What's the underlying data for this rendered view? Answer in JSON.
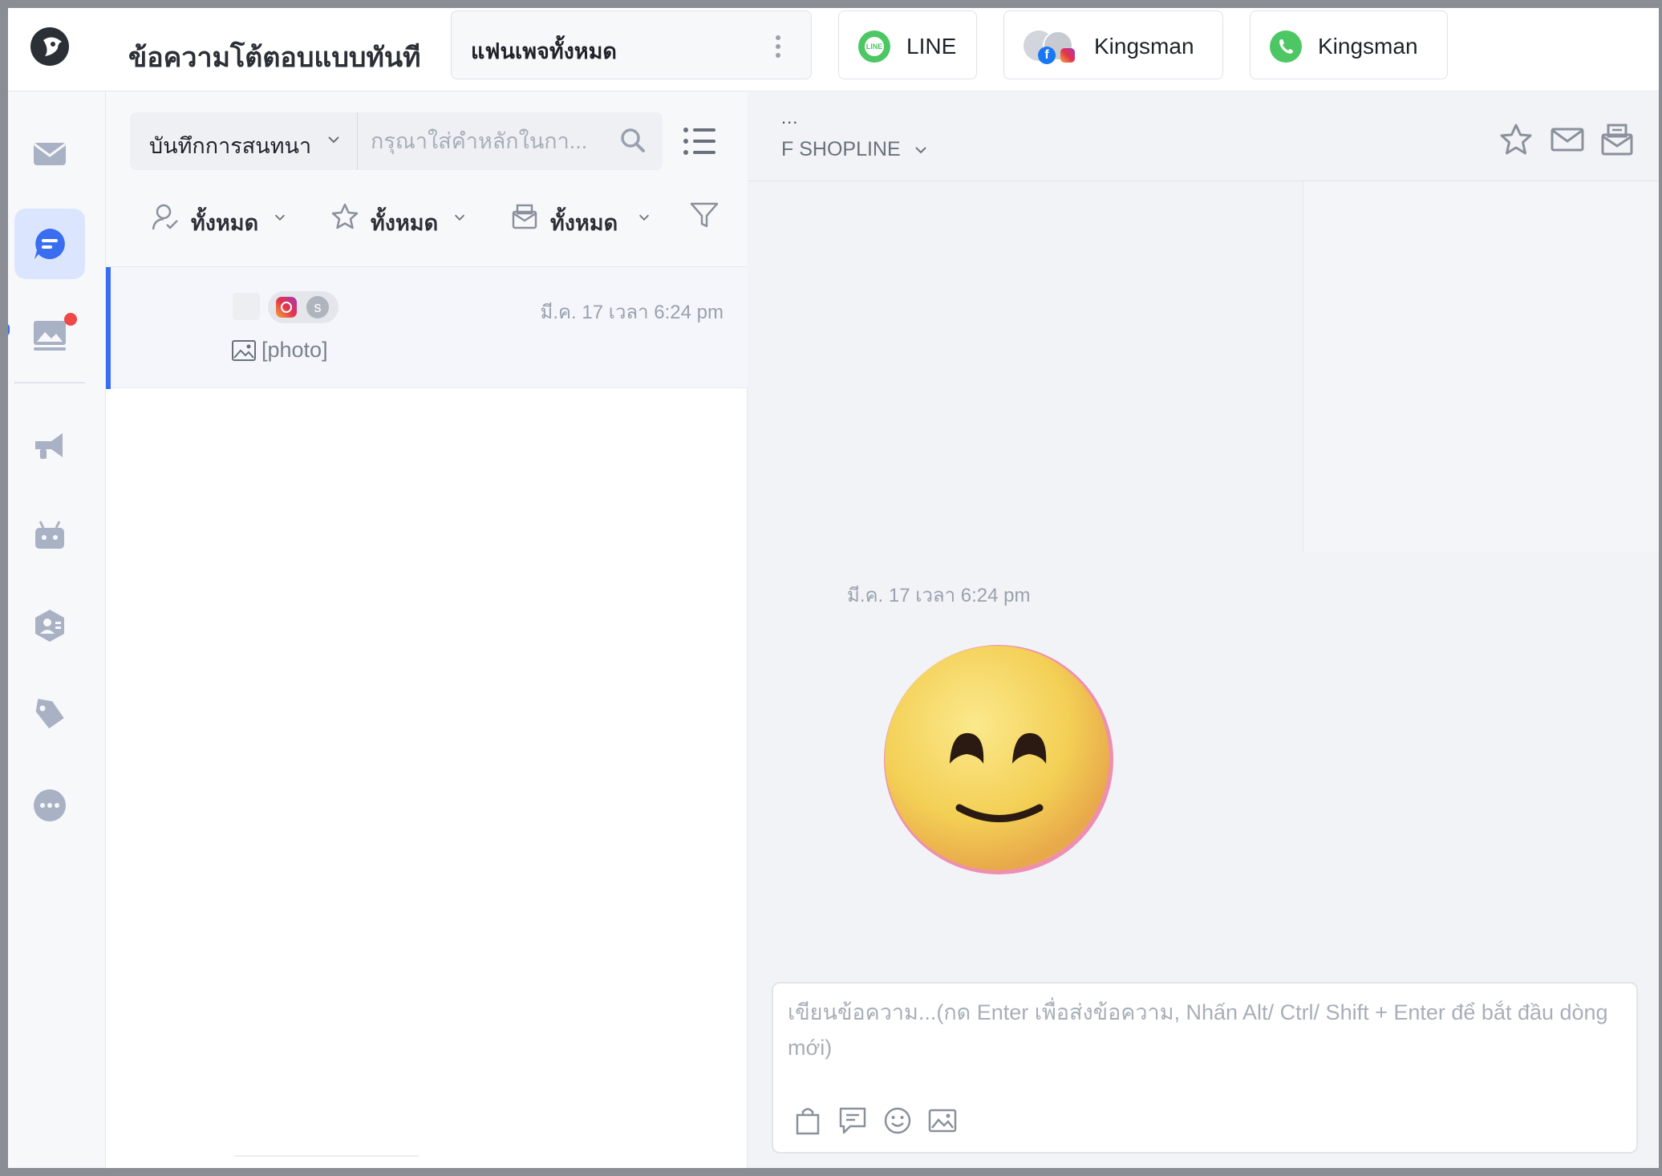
{
  "topbar": {
    "app_title": "ข้อความโต้ตอบแบบทันที",
    "page_selector": "แฟนเพจทั้งหมด",
    "channels": [
      {
        "name": "LINE",
        "icon": "line-icon"
      },
      {
        "name": "Kingsman",
        "icon": "facebook-instagram-stack-icon"
      },
      {
        "name": "Kingsman",
        "icon": "whatsapp-icon"
      }
    ]
  },
  "nav": {
    "items": [
      "inbox-icon",
      "chat-icon",
      "broadcast-image-icon",
      "megaphone-icon",
      "bot-icon",
      "customer-icon",
      "tag-icon",
      "more-icon"
    ],
    "active": "chat-icon",
    "accent": "#3a6df0"
  },
  "list": {
    "scope_label": "บันทึกการสนทนา",
    "search_placeholder": "กรุณาใส่คำหลักในกา...",
    "filters": [
      {
        "label": "ทั้งหมด",
        "icon": "assignee-icon"
      },
      {
        "label": "ทั้งหมด",
        "icon": "star-icon"
      },
      {
        "label": "ทั้งหมด",
        "icon": "mailbox-icon"
      }
    ],
    "conversations": [
      {
        "badge_letter": "s",
        "time": "มี.ค. 17 เวลา 6:24 pm",
        "preview": "[photo]"
      }
    ]
  },
  "chat": {
    "header_name": "...",
    "account": "F SHOPLINE",
    "message_time": "มี.ค. 17 เวลา 6:24 pm",
    "message_content": "smiling-face-emoji",
    "composer_placeholder": "เขียนข้อความ...(กด Enter เพื่อส่งข้อความ, Nhấn Alt/ Ctrl/ Shift + Enter để bắt đầu dòng mới)",
    "tools": [
      "product-bag-icon",
      "quick-reply-icon",
      "emoji-icon",
      "image-upload-icon"
    ]
  }
}
